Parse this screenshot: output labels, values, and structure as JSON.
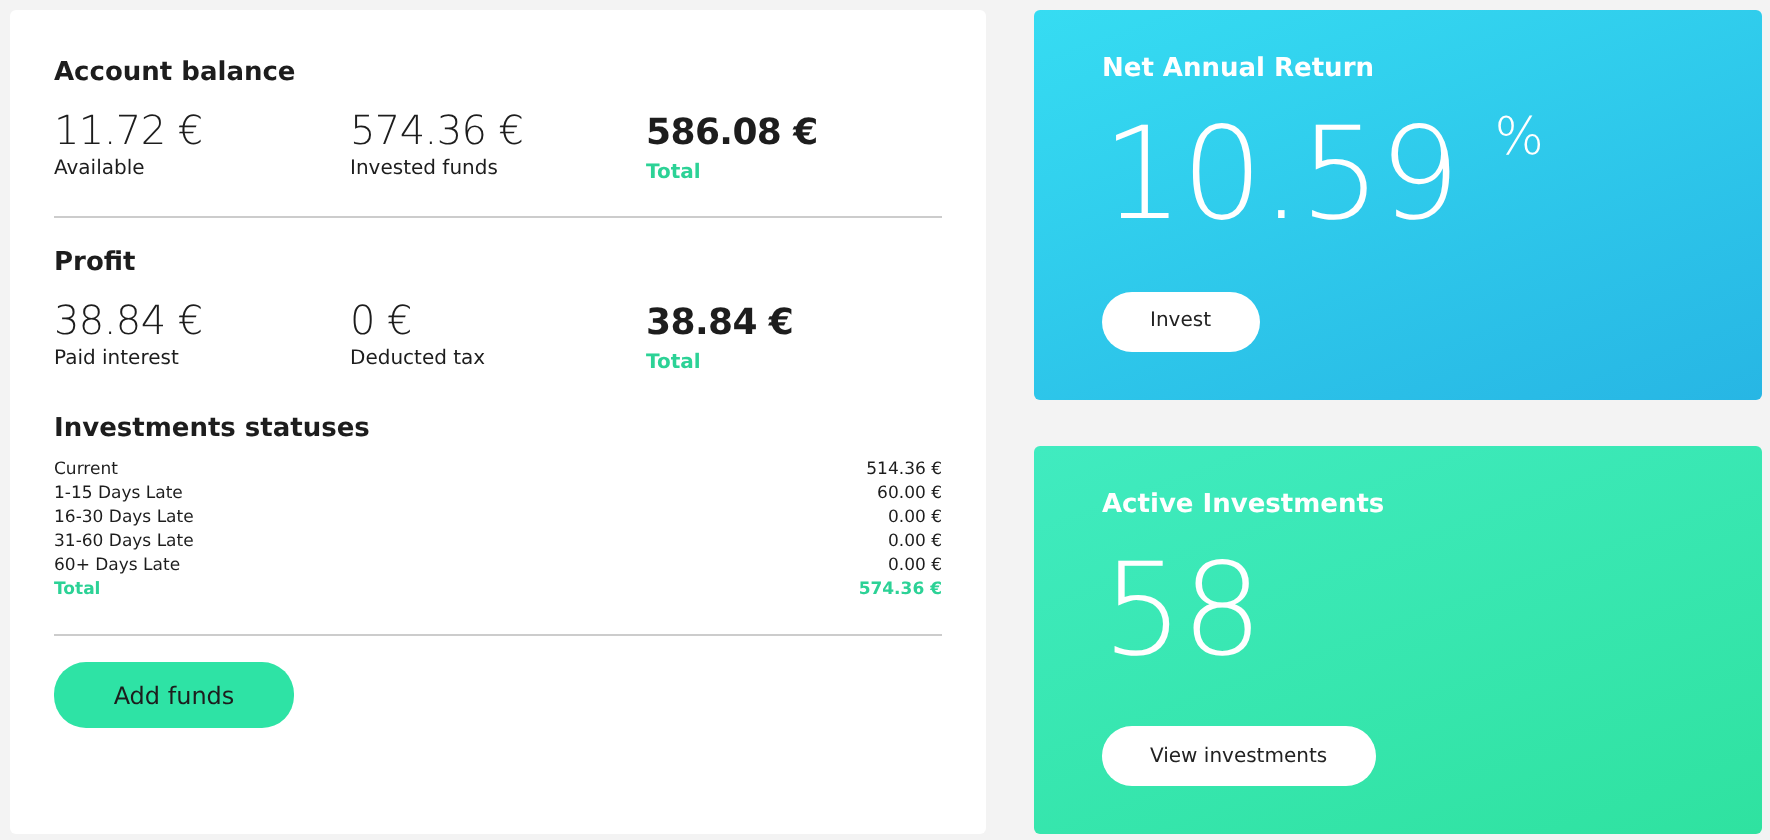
{
  "account_balance": {
    "title": "Account balance",
    "stats": [
      {
        "value": "11.72 €",
        "label": "Available",
        "kind": "part"
      },
      {
        "value": "574.36 €",
        "label": "Invested funds",
        "kind": "part"
      },
      {
        "value": "586.08 €",
        "label": "Total",
        "kind": "total"
      }
    ]
  },
  "profit": {
    "title": "Profit",
    "stats": [
      {
        "value": "38.84 €",
        "label": "Paid interest",
        "kind": "part"
      },
      {
        "value": "0 €",
        "label": "Deducted tax",
        "kind": "part"
      },
      {
        "value": "38.84 €",
        "label": "Total",
        "kind": "total"
      }
    ]
  },
  "investments_statuses": {
    "title": "Investments statuses",
    "rows": [
      {
        "label": "Current",
        "amount": "514.36 €",
        "kind": "item"
      },
      {
        "label": "1-15 Days Late",
        "amount": "60.00 €",
        "kind": "item"
      },
      {
        "label": "16-30 Days Late",
        "amount": "0.00 €",
        "kind": "item"
      },
      {
        "label": "31-60 Days Late",
        "amount": "0.00 €",
        "kind": "item"
      },
      {
        "label": "60+ Days Late",
        "amount": "0.00 €",
        "kind": "item"
      },
      {
        "label": "Total",
        "amount": "574.36 €",
        "kind": "total"
      }
    ]
  },
  "add_funds_button": "Add funds",
  "cards": [
    {
      "kind": "return",
      "title": "Net Annual Return",
      "value": "10.59",
      "unit": "%",
      "button": "Invest"
    },
    {
      "kind": "count",
      "title": "Active Investments",
      "value": "58",
      "button": "View investments"
    }
  ]
}
